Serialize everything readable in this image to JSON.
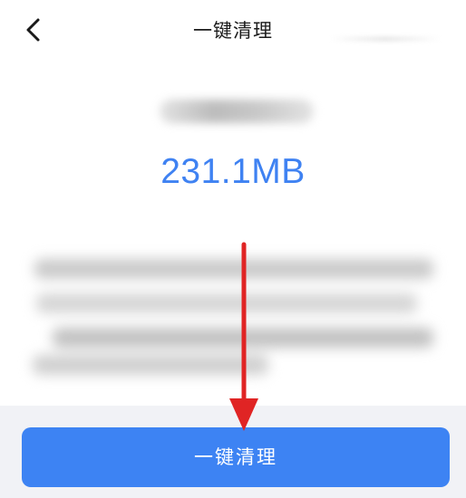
{
  "nav": {
    "title": "一键清理",
    "back_icon": "chevron-left-icon"
  },
  "summary": {
    "size_value": "231.1MB"
  },
  "action": {
    "clean_button_label": "一键清理"
  },
  "annotation": {
    "arrow_color": "#e02424",
    "arrow_direction": "down"
  },
  "colors": {
    "accent": "#3d83f3",
    "size_text": "#3f82f2",
    "bottom_bar_bg": "#f1f2f6"
  }
}
